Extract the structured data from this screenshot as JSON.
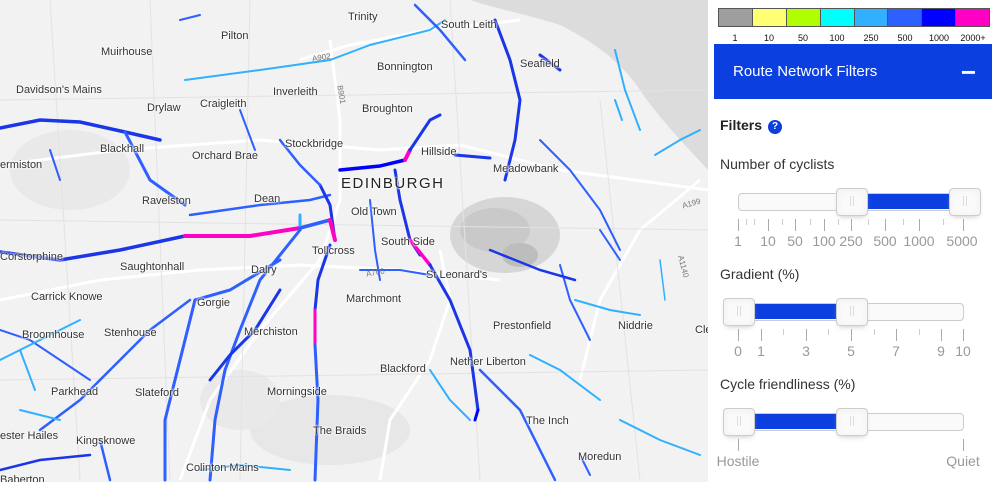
{
  "legend": {
    "colors": [
      "#9e9e9e",
      "#ffff73",
      "#afff00",
      "#00ffff",
      "#30b0ff",
      "#2e5fff",
      "#0000ff",
      "#ff00c5"
    ],
    "labels": [
      "1",
      "10",
      "50",
      "100",
      "250",
      "500",
      "1000",
      "2000+"
    ]
  },
  "panel": {
    "title": "Route Network Filters",
    "collapse_symbol": "−",
    "filters_heading": "Filters",
    "help_symbol": "?"
  },
  "sliders": {
    "cyclists": {
      "label": "Number of cyclists",
      "pips": [
        "1",
        "10",
        "50",
        "100",
        "250",
        "500",
        "1000",
        "5000"
      ],
      "lower": "250",
      "upper": "5000"
    },
    "gradient": {
      "label": "Gradient (%)",
      "pips": [
        "0",
        "1",
        "3",
        "5",
        "7",
        "9",
        "10"
      ],
      "lower": "0",
      "upper": "5"
    },
    "friendliness": {
      "label": "Cycle friendliness (%)",
      "pips": [
        "Hostile",
        "Quiet"
      ],
      "lower_fraction": 0.0,
      "upper_fraction": 0.5
    }
  },
  "map": {
    "places": [
      {
        "name": "Trinity",
        "cls": ""
      },
      {
        "name": "South Leith",
        "cls": ""
      },
      {
        "name": "Muirhouse",
        "cls": ""
      },
      {
        "name": "Pilton",
        "cls": ""
      },
      {
        "name": "Seafield",
        "cls": ""
      },
      {
        "name": "Bonnington",
        "cls": ""
      },
      {
        "name": "Davidson's Mains",
        "cls": ""
      },
      {
        "name": "Inverleith",
        "cls": ""
      },
      {
        "name": "Drylaw",
        "cls": ""
      },
      {
        "name": "Craigleith",
        "cls": ""
      },
      {
        "name": "Broughton",
        "cls": ""
      },
      {
        "name": "Blackhall",
        "cls": ""
      },
      {
        "name": "Stockbridge",
        "cls": ""
      },
      {
        "name": "Hillside",
        "cls": ""
      },
      {
        "name": "ermiston",
        "cls": ""
      },
      {
        "name": "Orchard Brae",
        "cls": ""
      },
      {
        "name": "Meadowbank",
        "cls": ""
      },
      {
        "name": "EDINBURGH",
        "cls": "city"
      },
      {
        "name": "Ravelston",
        "cls": ""
      },
      {
        "name": "Dean",
        "cls": ""
      },
      {
        "name": "Old Town",
        "cls": ""
      },
      {
        "name": "South Side",
        "cls": ""
      },
      {
        "name": "Corstorphine",
        "cls": ""
      },
      {
        "name": "Tollcross",
        "cls": ""
      },
      {
        "name": "Saughtonhall",
        "cls": ""
      },
      {
        "name": "Dalry",
        "cls": ""
      },
      {
        "name": "St Leonard's",
        "cls": ""
      },
      {
        "name": "Carrick Knowe",
        "cls": ""
      },
      {
        "name": "Gorgie",
        "cls": ""
      },
      {
        "name": "Marchmont",
        "cls": ""
      },
      {
        "name": "Broomhouse",
        "cls": ""
      },
      {
        "name": "Stenhouse",
        "cls": ""
      },
      {
        "name": "Prestonfield",
        "cls": ""
      },
      {
        "name": "Niddrie",
        "cls": ""
      },
      {
        "name": "Merchiston",
        "cls": ""
      },
      {
        "name": "Cle",
        "cls": ""
      },
      {
        "name": "Nether Liberton",
        "cls": ""
      },
      {
        "name": "Parkhead",
        "cls": ""
      },
      {
        "name": "Slateford",
        "cls": ""
      },
      {
        "name": "Morningside",
        "cls": ""
      },
      {
        "name": "Blackford",
        "cls": ""
      },
      {
        "name": "ester Hailes",
        "cls": ""
      },
      {
        "name": "Kingsknowe",
        "cls": ""
      },
      {
        "name": "The Braids",
        "cls": ""
      },
      {
        "name": "The Inch",
        "cls": ""
      },
      {
        "name": "Baberton",
        "cls": ""
      },
      {
        "name": "Colinton Mains",
        "cls": ""
      },
      {
        "name": "Moredun",
        "cls": ""
      }
    ],
    "road_labels": [
      "A902",
      "B901",
      "A700",
      "A199",
      "A1140"
    ]
  }
}
